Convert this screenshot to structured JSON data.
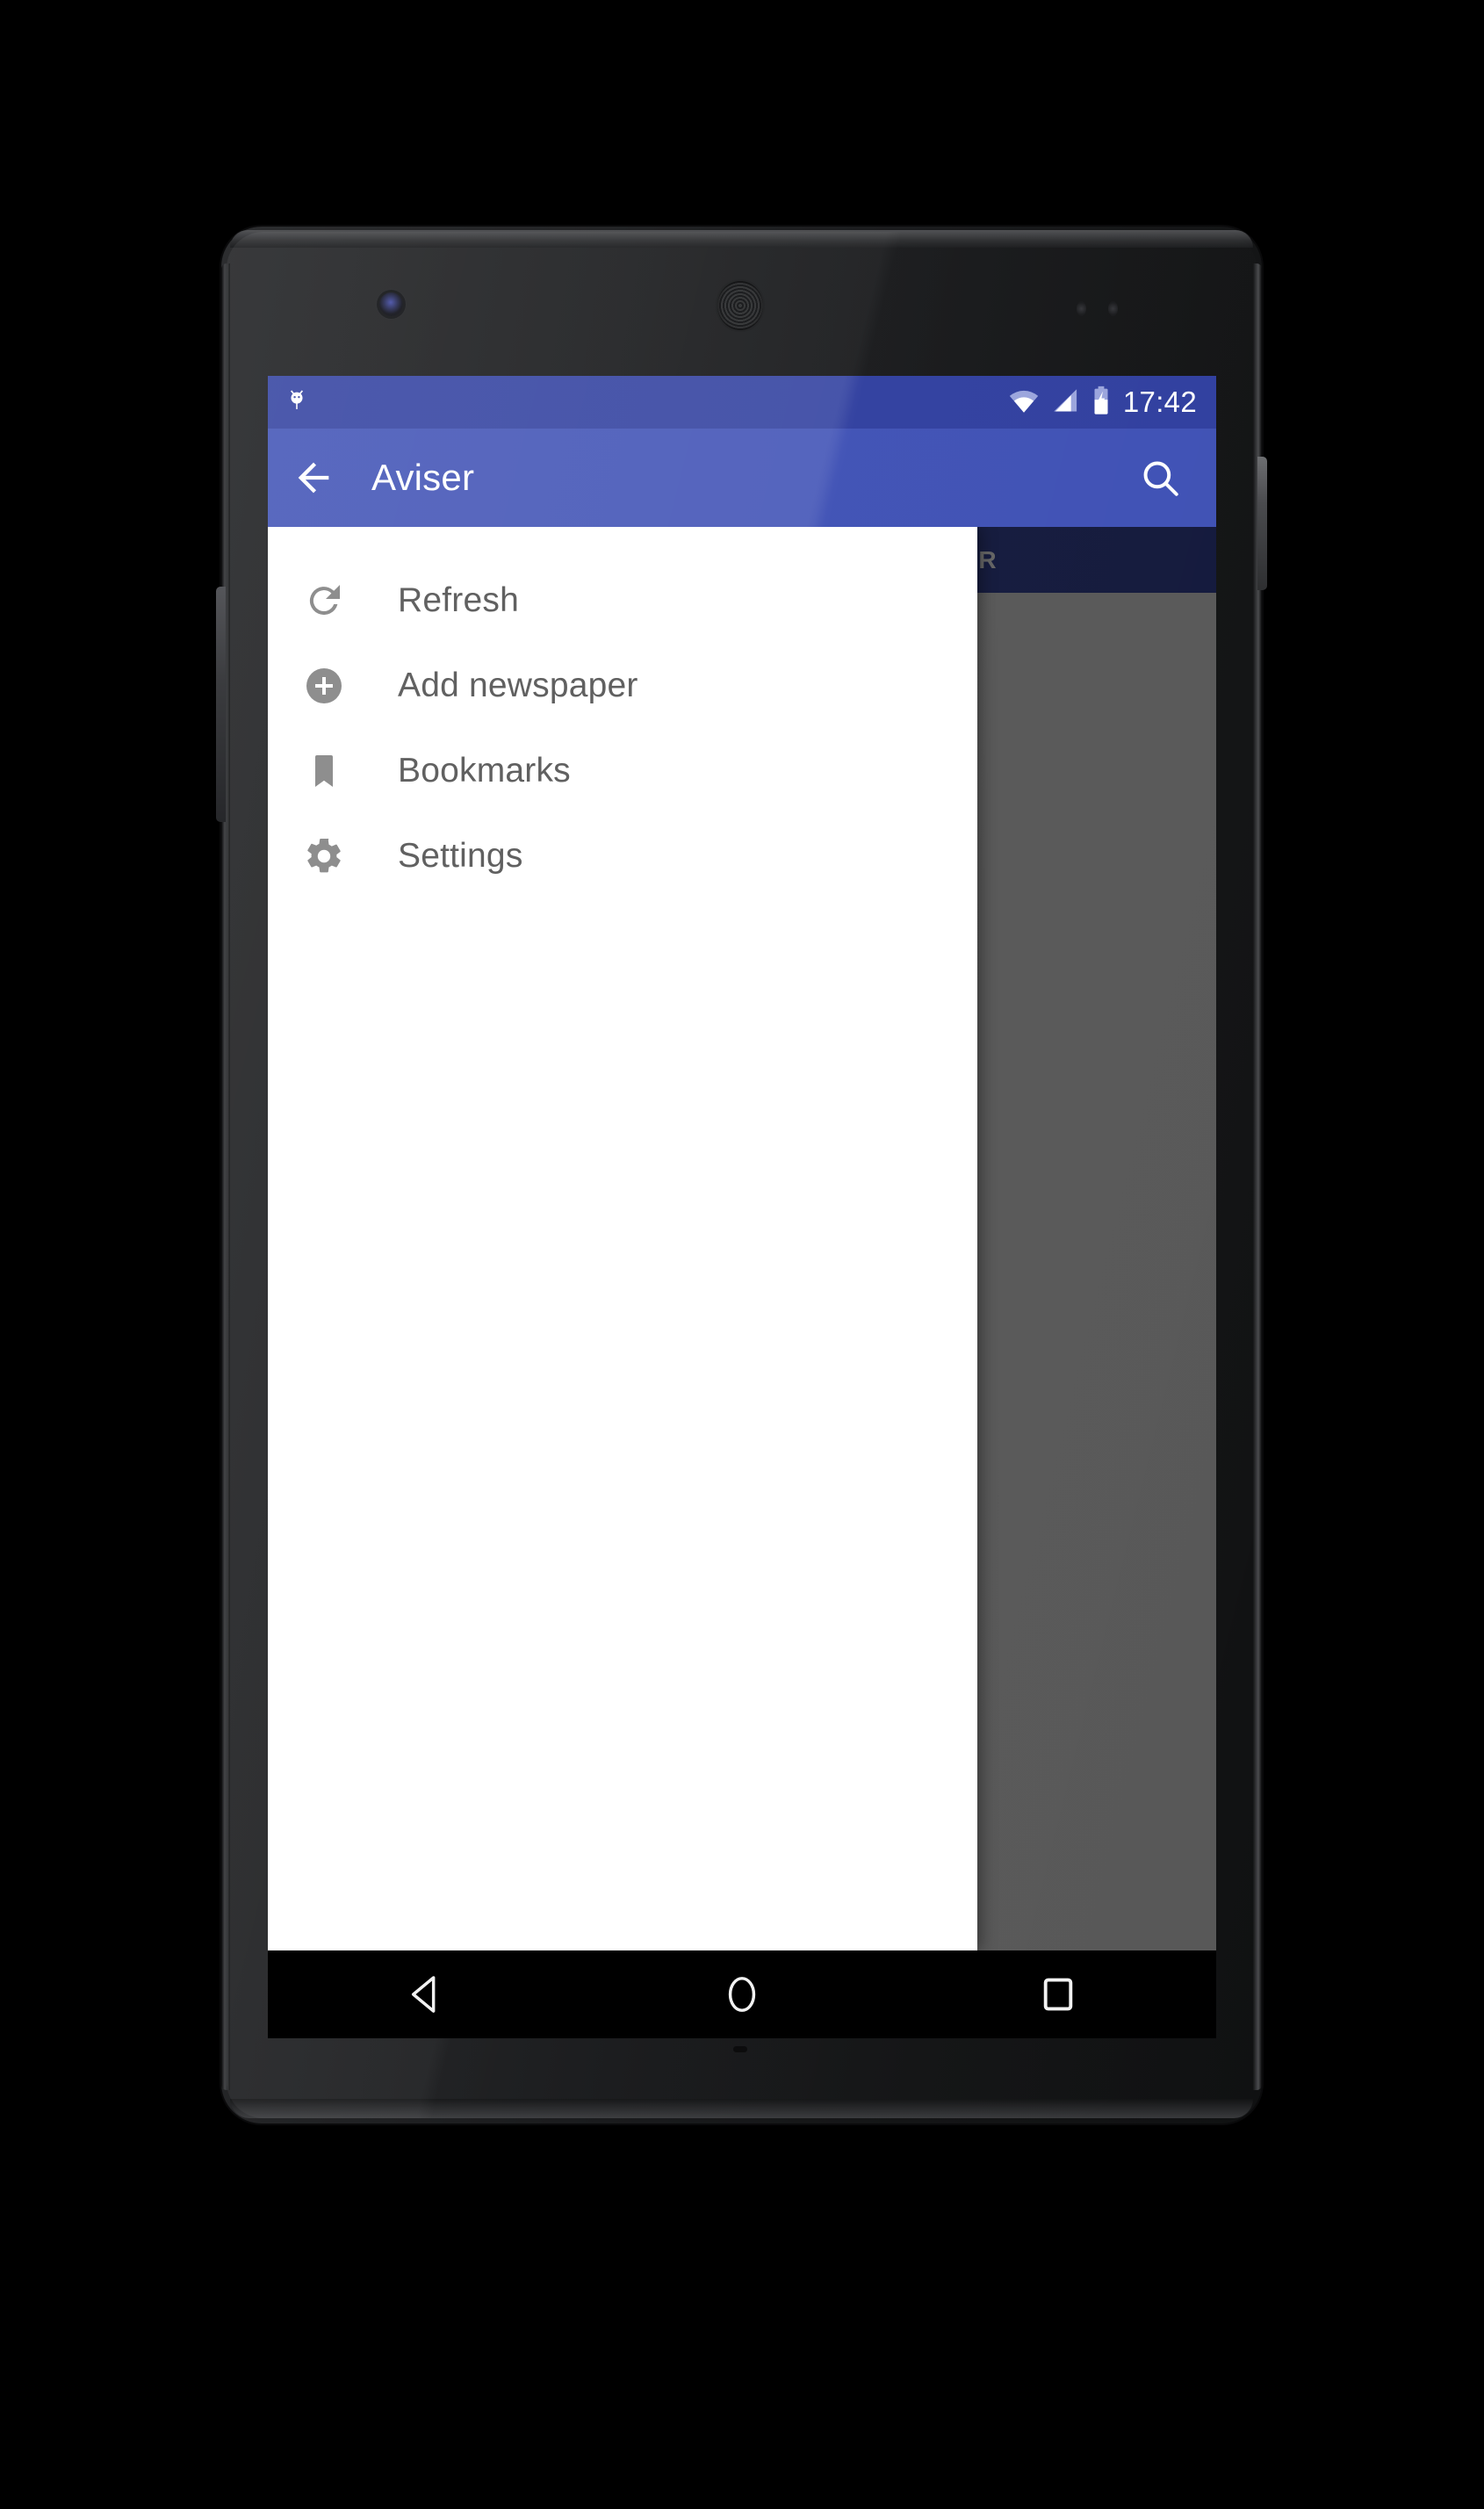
{
  "device": {
    "name": "android-phone-mockup",
    "front_camera": "front-camera",
    "earpiece": "earpiece-speaker",
    "power_button": "power-button",
    "volume_button": "volume-rocker"
  },
  "status_bar": {
    "background": "#303F9F",
    "notification_icon": "android-bug-icon",
    "wifi_icon": "wifi-icon",
    "signal_icon": "cellular-signal-icon",
    "battery_icon": "battery-charging-icon",
    "time": "17:42"
  },
  "app_bar": {
    "background": "#3F51B5",
    "back_icon": "arrow-back-icon",
    "title": "Aviser",
    "search_icon": "search-icon"
  },
  "background_content": {
    "tab_strip_background": "#1B2354",
    "tab_label": "RITTER",
    "scrim_color": "#7B7B7B"
  },
  "drawer": {
    "background": "#FFFFFF",
    "items": [
      {
        "icon": "refresh-icon",
        "label": "Refresh"
      },
      {
        "icon": "add-circle-icon",
        "label": "Add newspaper"
      },
      {
        "icon": "bookmark-icon",
        "label": "Bookmarks"
      },
      {
        "icon": "settings-gear-icon",
        "label": "Settings"
      }
    ]
  },
  "nav_bar": {
    "background": "#000000",
    "back": "nav-back-icon",
    "home": "nav-home-icon",
    "recents": "nav-recents-icon"
  }
}
